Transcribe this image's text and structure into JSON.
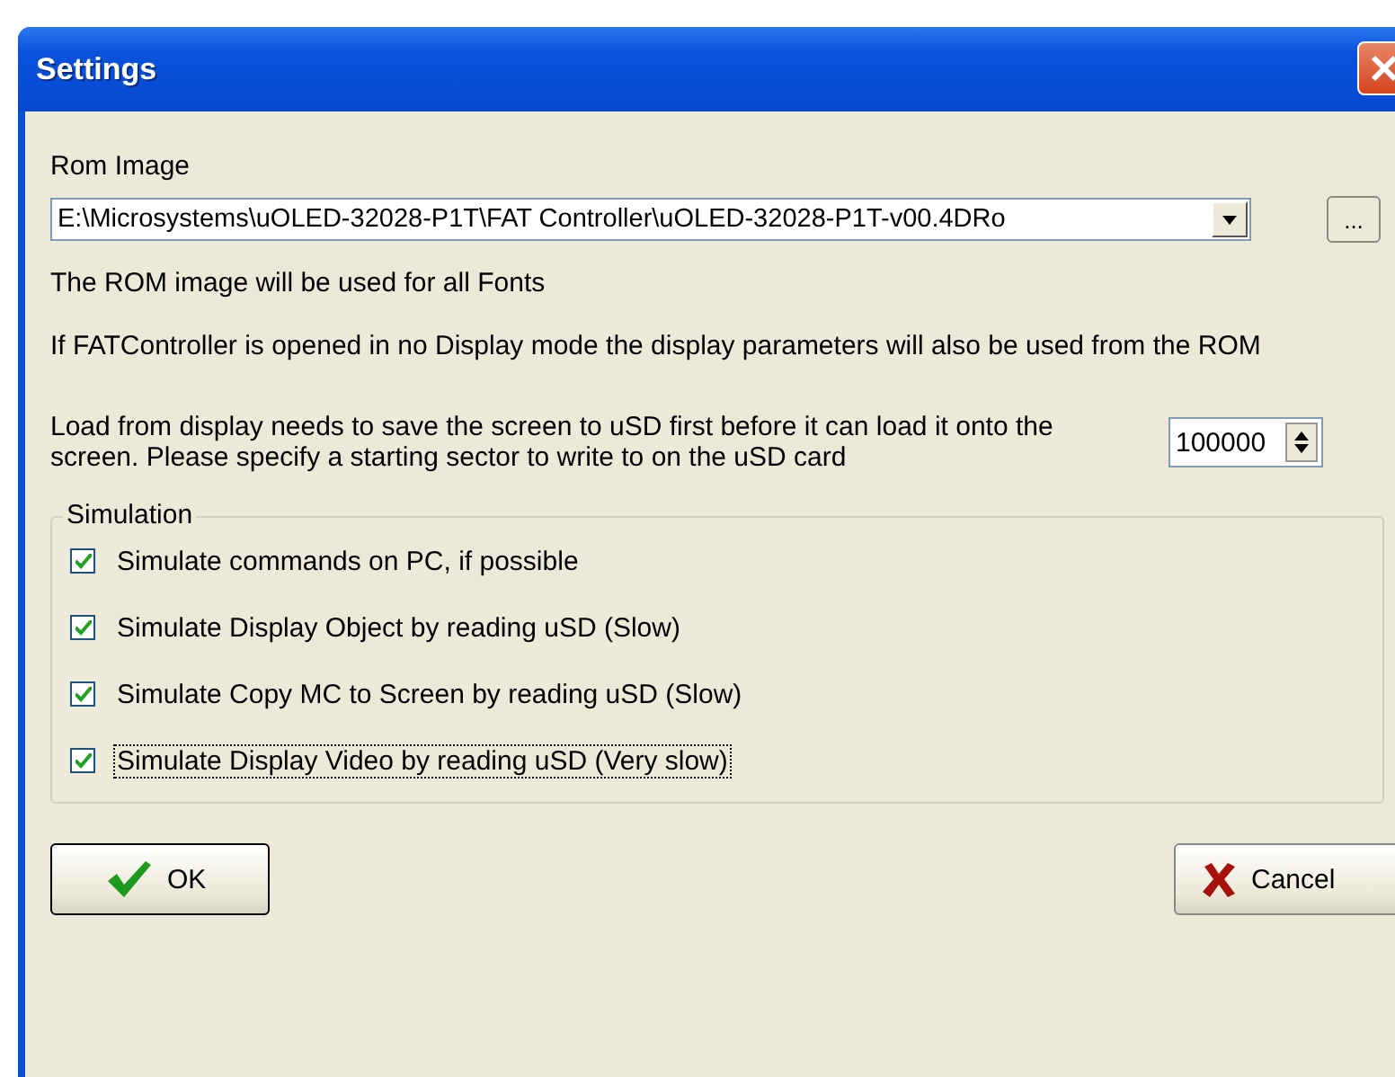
{
  "window": {
    "title": "Settings"
  },
  "rom_image": {
    "label": "Rom Image",
    "value": "E:\\Microsystems\\uOLED-32028-P1T\\FAT Controller\\uOLED-32028-P1T-v00.4DRo",
    "browse": "..."
  },
  "notes": [
    "The ROM image will be used for all Fonts",
    "If FATController is opened in no Display mode the display parameters will also be used from the ROM"
  ],
  "sector": {
    "label": "Load from display needs to save the screen to uSD first before it can load it onto the screen. Please specify a starting sector to write to on the uSD card",
    "value": "100000"
  },
  "simulation": {
    "title": "Simulation",
    "options": [
      {
        "label": "Simulate commands on PC, if possible",
        "checked": true,
        "focused": false
      },
      {
        "label": "Simulate Display Object by reading uSD (Slow)",
        "checked": true,
        "focused": false
      },
      {
        "label": "Simulate Copy MC to Screen by reading uSD (Slow)",
        "checked": true,
        "focused": false
      },
      {
        "label": "Simulate Display Video by reading uSD (Very slow)",
        "checked": true,
        "focused": true
      }
    ]
  },
  "buttons": [
    {
      "kind": "ok",
      "label": "OK"
    },
    {
      "kind": "cancel",
      "label": "Cancel"
    }
  ]
}
